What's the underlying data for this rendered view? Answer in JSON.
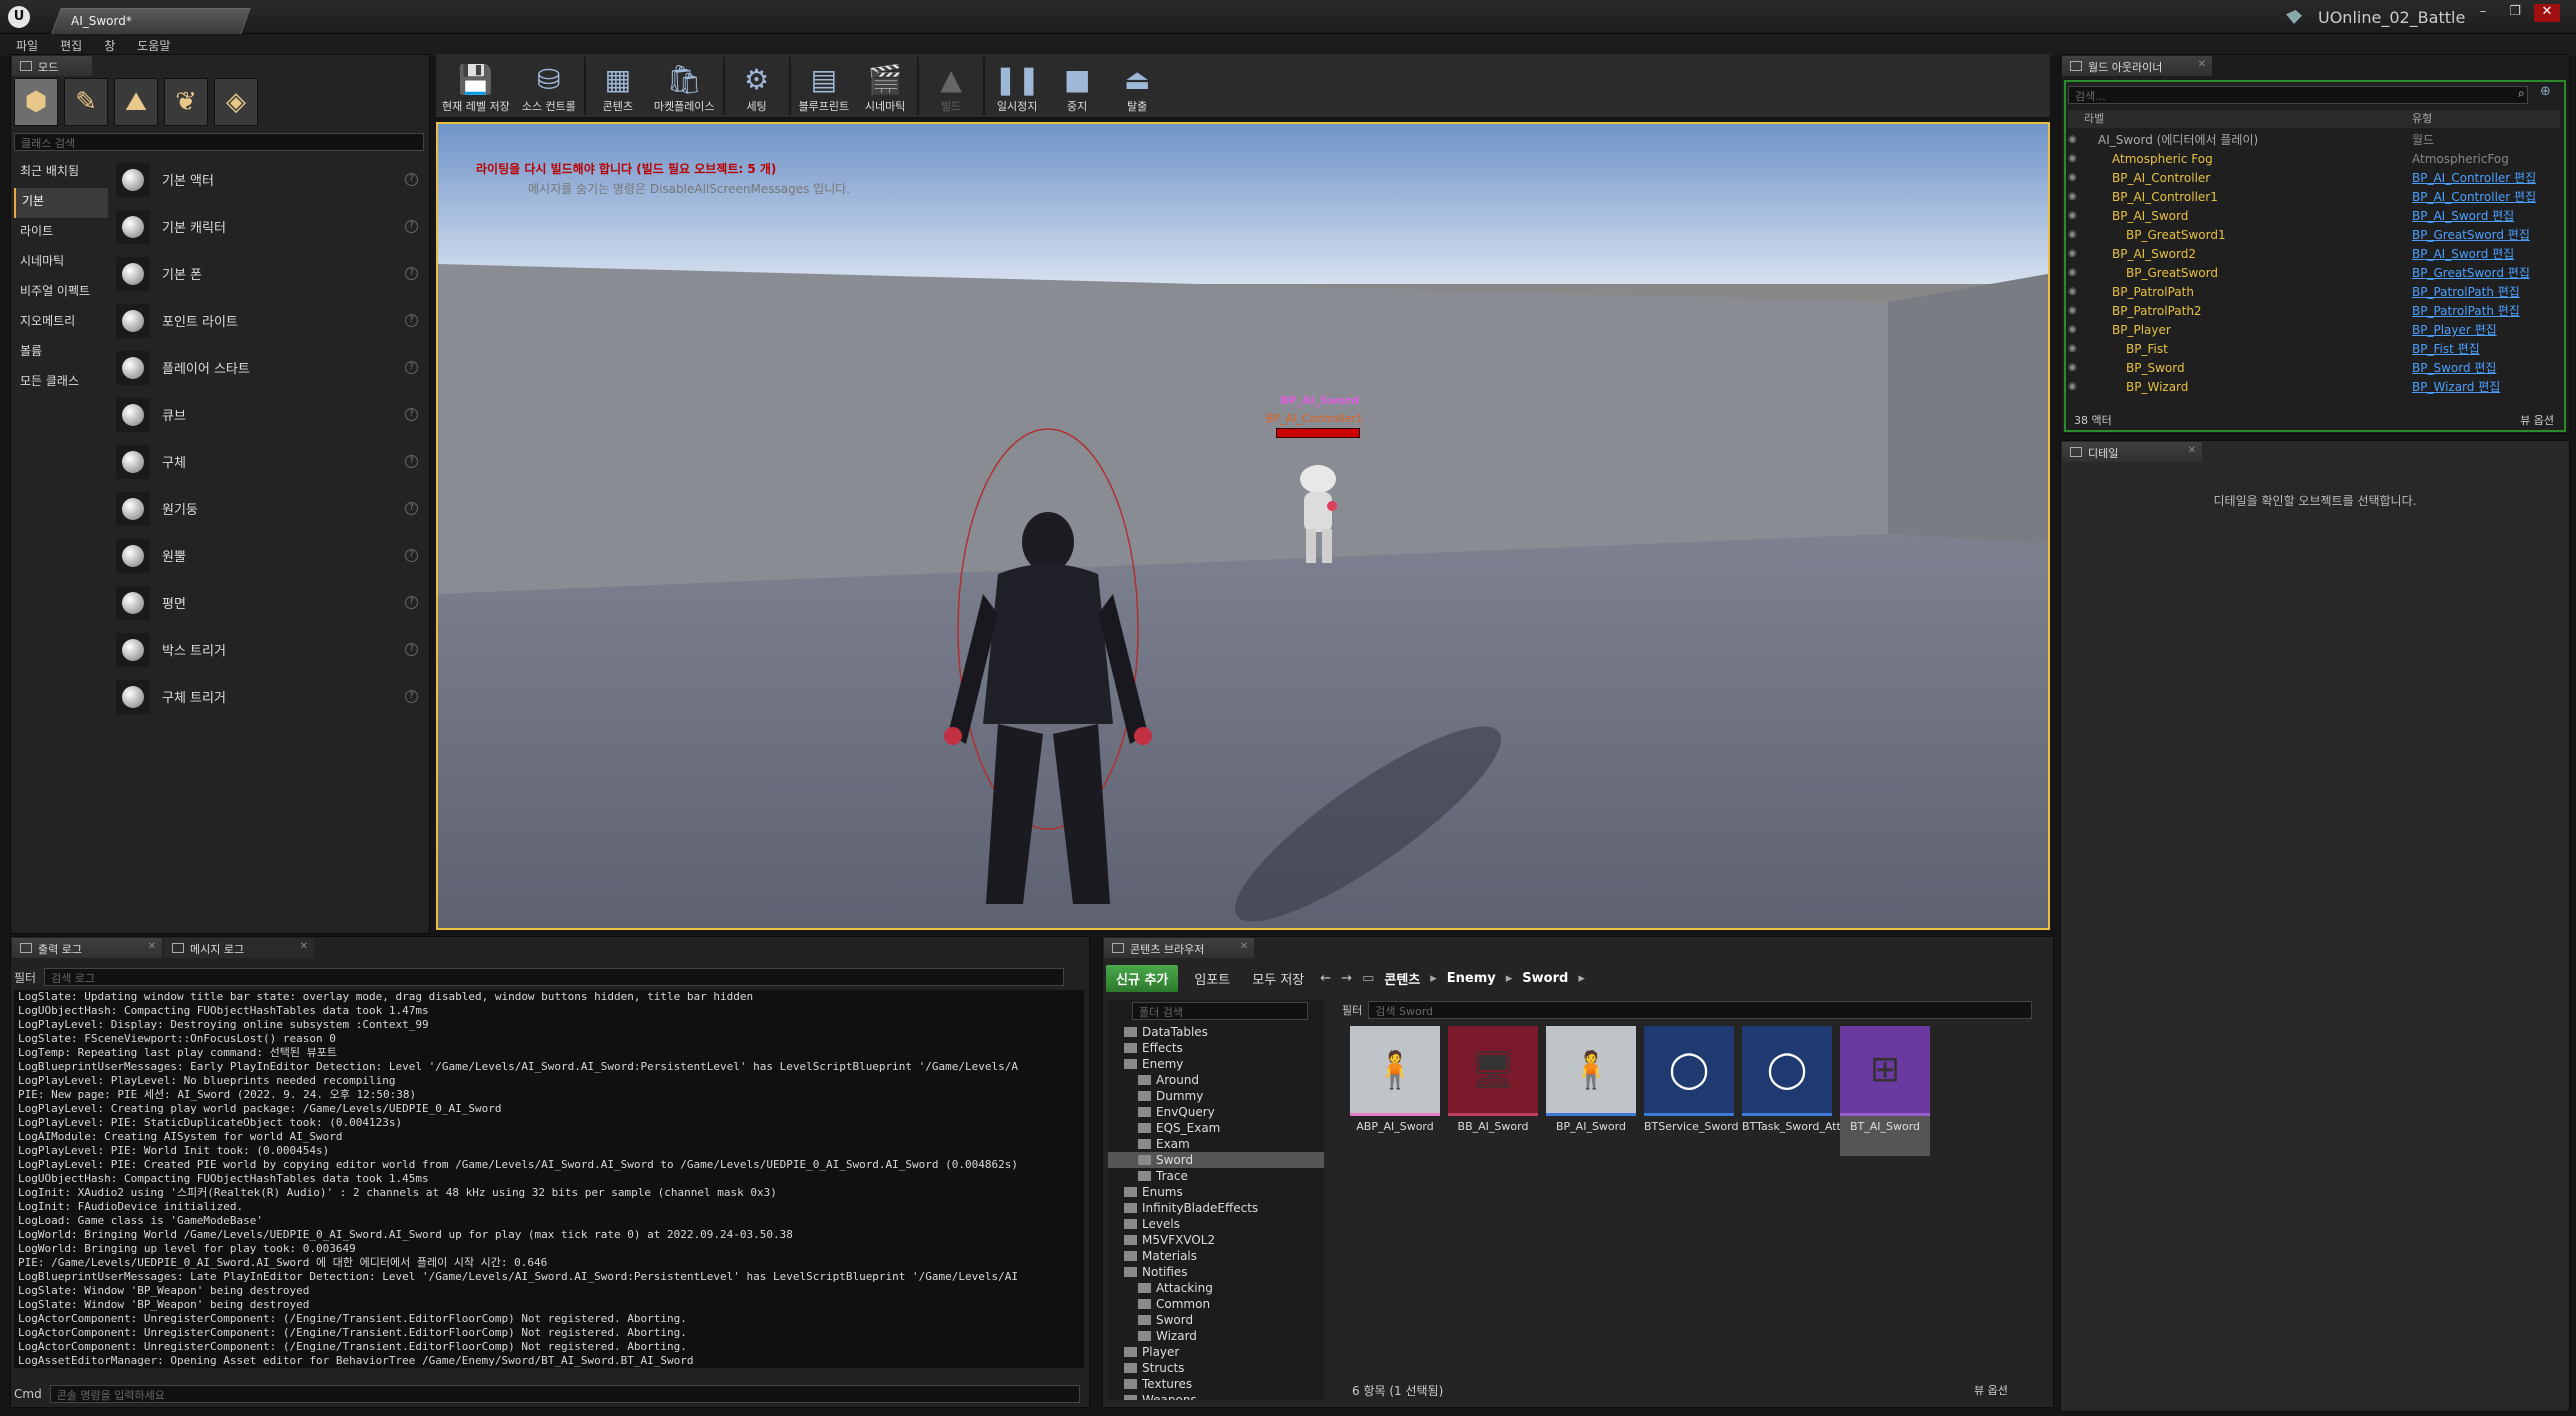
{
  "window": {
    "tab": "AI_Sword*",
    "project": "UOnline_02_Battle",
    "logo": "U"
  },
  "menu": [
    "파일",
    "편집",
    "창",
    "도움말"
  ],
  "modes": {
    "tab": "모드",
    "search_placeholder": "클래스 검색",
    "categories": [
      "최근 배치됨",
      "기본",
      "라이트",
      "시네마틱",
      "비주얼 이펙트",
      "지오메트리",
      "볼륨",
      "모든 클래스"
    ],
    "selected_category": "기본",
    "items": [
      "기본 액터",
      "기본 캐릭터",
      "기본 폰",
      "포인트 라이트",
      "플레이어 스타트",
      "큐브",
      "구체",
      "원기둥",
      "원뿔",
      "평면",
      "박스 트리거",
      "구체 트리거"
    ]
  },
  "toolbar": [
    {
      "label": "현재 레벨 저장",
      "icon": "💾"
    },
    {
      "label": "소스 컨트롤",
      "icon": "⛁"
    },
    {
      "label": "콘텐츠",
      "icon": "▦"
    },
    {
      "label": "마켓플레이스",
      "icon": "🛍"
    },
    {
      "label": "세팅",
      "icon": "⚙"
    },
    {
      "label": "블루프린트",
      "icon": "▤"
    },
    {
      "label": "시네마틱",
      "icon": "🎬"
    },
    {
      "label": "빌드",
      "icon": "▲"
    },
    {
      "label": "일시정지",
      "icon": "❚❚"
    },
    {
      "label": "중지",
      "icon": "■"
    },
    {
      "label": "탈출",
      "icon": "⏏"
    }
  ],
  "viewport": {
    "error": "라이팅을 다시 빌드해야 합니다 (빌드 필요 오브젝트: 5 개)",
    "hint": "메시지를 숨기는 명령은 DisableAllScreenMessages 입니다.",
    "enemy_name": "BP_AI_Sword",
    "enemy_controller": "BP_AI_Controller1",
    "health_fraction": 1.0
  },
  "outliner": {
    "tab": "월드 아웃라이너",
    "search_placeholder": "검색...",
    "col_label": "라벨",
    "col_type": "유형",
    "count": "38 액터",
    "view_options": "뷰 옵션",
    "rows": [
      {
        "name": "AI_Sword (에디터에서 플레이)",
        "type": "월드",
        "link": false,
        "lvl": 0
      },
      {
        "name": "Atmospheric Fog",
        "type": "AtmosphericFog",
        "link": false,
        "lvl": 1
      },
      {
        "name": "BP_AI_Controller",
        "type": "BP_AI_Controller 편집",
        "link": true,
        "lvl": 1
      },
      {
        "name": "BP_AI_Controller1",
        "type": "BP_AI_Controller 편집",
        "link": true,
        "lvl": 1
      },
      {
        "name": "BP_AI_Sword",
        "type": "BP_AI_Sword 편집",
        "link": true,
        "lvl": 1
      },
      {
        "name": "BP_GreatSword1",
        "type": "BP_GreatSword 편집",
        "link": true,
        "lvl": 2
      },
      {
        "name": "BP_AI_Sword2",
        "type": "BP_AI_Sword 편집",
        "link": true,
        "lvl": 1
      },
      {
        "name": "BP_GreatSword",
        "type": "BP_GreatSword 편집",
        "link": true,
        "lvl": 2
      },
      {
        "name": "BP_PatrolPath",
        "type": "BP_PatrolPath 편집",
        "link": true,
        "lvl": 1
      },
      {
        "name": "BP_PatrolPath2",
        "type": "BP_PatrolPath 편집",
        "link": true,
        "lvl": 1
      },
      {
        "name": "BP_Player",
        "type": "BP_Player 편집",
        "link": true,
        "lvl": 1
      },
      {
        "name": "BP_Fist",
        "type": "BP_Fist 편집",
        "link": true,
        "lvl": 2
      },
      {
        "name": "BP_Sword",
        "type": "BP_Sword 편집",
        "link": true,
        "lvl": 2
      },
      {
        "name": "BP_Wizard",
        "type": "BP_Wizard 편집",
        "link": true,
        "lvl": 2
      }
    ]
  },
  "details": {
    "tab": "디테일",
    "message": "디테일을 확인할 오브젝트를 선택합니다."
  },
  "output_log": {
    "tab": "출력 로그",
    "tab2": "메시지 로그",
    "filter": "필터",
    "search_placeholder": "검색 로그",
    "cmd": "Cmd",
    "cmd_placeholder": "콘솔 명령을 입력하세요",
    "lines": [
      "LogSlate: Updating window title bar state: overlay mode, drag disabled, window buttons hidden, title bar hidden",
      "LogUObjectHash: Compacting FUObjectHashTables data took   1.47ms",
      "LogPlayLevel: Display: Destroying online subsystem :Context_99",
      "LogSlate: FSceneViewport::OnFocusLost() reason 0",
      "LogTemp: Repeating last play command: 선택된 뷰포트",
      "LogBlueprintUserMessages: Early PlayInEditor Detection: Level '/Game/Levels/AI_Sword.AI_Sword:PersistentLevel' has LevelScriptBlueprint '/Game/Levels/A",
      "LogPlayLevel: PlayLevel: No blueprints needed recompiling",
      "PIE: New page: PIE 세션: AI_Sword (2022. 9. 24. 오후 12:50:38)",
      "LogPlayLevel: Creating play world package: /Game/Levels/UEDPIE_0_AI_Sword",
      "LogPlayLevel: PIE: StaticDuplicateObject took: (0.004123s)",
      "LogAIModule: Creating AISystem for world AI_Sword",
      "LogPlayLevel: PIE: World Init took: (0.000454s)",
      "LogPlayLevel: PIE: Created PIE world by copying editor world from /Game/Levels/AI_Sword.AI_Sword to /Game/Levels/UEDPIE_0_AI_Sword.AI_Sword (0.004862s)",
      "LogUObjectHash: Compacting FUObjectHashTables data took   1.45ms",
      "LogInit: XAudio2 using '스피커(Realtek(R) Audio)' : 2 channels at 48 kHz using 32 bits per sample (channel mask 0x3)",
      "LogInit: FAudioDevice initialized.",
      "LogLoad: Game class is 'GameModeBase'",
      "LogWorld: Bringing World /Game/Levels/UEDPIE_0_AI_Sword.AI_Sword up for play (max tick rate 0) at 2022.09.24-03.50.38",
      "LogWorld: Bringing up level for play took: 0.003649",
      "PIE: /Game/Levels/UEDPIE_0_AI_Sword.AI_Sword 에 대한 에디터에서 플레이 시작 시간: 0.646",
      "LogBlueprintUserMessages: Late PlayInEditor Detection: Level '/Game/Levels/AI_Sword.AI_Sword:PersistentLevel' has LevelScriptBlueprint '/Game/Levels/AI",
      "LogSlate: Window 'BP_Weapon' being destroyed",
      "LogSlate: Window 'BP_Weapon' being destroyed",
      "LogActorComponent: UnregisterComponent: (/Engine/Transient.EditorFloorComp) Not registered. Aborting.",
      "LogActorComponent: UnregisterComponent: (/Engine/Transient.EditorFloorComp) Not registered. Aborting.",
      "LogActorComponent: UnregisterComponent: (/Engine/Transient.EditorFloorComp) Not registered. Aborting.",
      "LogAssetEditorManager: Opening Asset editor for BehaviorTree /Game/Enemy/Sword/BT_AI_Sword.BT_AI_Sword"
    ]
  },
  "content_browser": {
    "tab": "콘텐츠 브라우저",
    "add": "신규 추가",
    "import": "임포트",
    "save_all": "모두 저장",
    "breadcrumb": [
      "콘텐츠",
      "Enemy",
      "Sword"
    ],
    "folder_search": "폴더 검색",
    "filter": "필터",
    "asset_search": "검색 Sword",
    "status": "6 항목 (1 선택됨)",
    "view_options": "뷰 옵션",
    "folders": [
      {
        "name": "DataTables",
        "d": 0
      },
      {
        "name": "Effects",
        "d": 0
      },
      {
        "name": "Enemy",
        "d": 0
      },
      {
        "name": "Around",
        "d": 1
      },
      {
        "name": "Dummy",
        "d": 1
      },
      {
        "name": "EnvQuery",
        "d": 1
      },
      {
        "name": "EQS_Exam",
        "d": 1
      },
      {
        "name": "Exam",
        "d": 1
      },
      {
        "name": "Sword",
        "d": 1,
        "sel": true
      },
      {
        "name": "Trace",
        "d": 1
      },
      {
        "name": "Enums",
        "d": 0
      },
      {
        "name": "InfinityBladeEffects",
        "d": 0
      },
      {
        "name": "Levels",
        "d": 0
      },
      {
        "name": "M5VFXVOL2",
        "d": 0
      },
      {
        "name": "Materials",
        "d": 0
      },
      {
        "name": "Notifies",
        "d": 0
      },
      {
        "name": "Attacking",
        "d": 1
      },
      {
        "name": "Common",
        "d": 1
      },
      {
        "name": "Sword",
        "d": 1
      },
      {
        "name": "Wizard",
        "d": 1
      },
      {
        "name": "Player",
        "d": 0
      },
      {
        "name": "Structs",
        "d": 0
      },
      {
        "name": "Textures",
        "d": 0
      },
      {
        "name": "Weapons",
        "d": 0
      }
    ],
    "assets": [
      {
        "name": "ABP_AI_Sword",
        "icon": "🧍",
        "bg": "#bfc4c8",
        "accent": "#e57ac0"
      },
      {
        "name": "BB_AI_Sword",
        "icon": "🖥",
        "bg": "#7a1a2a",
        "accent": "#c04060"
      },
      {
        "name": "BP_AI_Sword",
        "icon": "🧍",
        "bg": "#bfc4c8",
        "accent": "#3d7ad8"
      },
      {
        "name": "BTService_Sword",
        "icon": "◯",
        "bg": "#1e3a70",
        "accent": "#3d7ad8"
      },
      {
        "name": "BTTask_Sword_Attack",
        "icon": "◯",
        "bg": "#1e3a70",
        "accent": "#3d7ad8"
      },
      {
        "name": "BT_AI_Sword",
        "icon": "⊞",
        "bg": "#6a3aa0",
        "accent": "#9a60d0"
      }
    ]
  },
  "colors": {
    "accent_yellow": "#e8c040",
    "link_blue": "#4aa0ff",
    "add_green": "#3a8f3a",
    "error_red": "#b00000"
  }
}
